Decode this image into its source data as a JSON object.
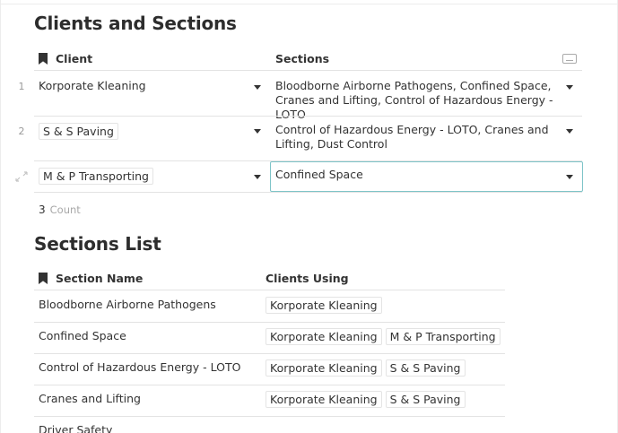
{
  "clients_table": {
    "title": "Clients and Sections",
    "columns": {
      "client": "Client",
      "sections": "Sections"
    },
    "rows": [
      {
        "num": "1",
        "client": "Korporate Kleaning",
        "sections": "Bloodborne Airborne Pathogens, Confined Space, Cranes and Lifting, Control of Hazardous Energy - LOTO"
      },
      {
        "num": "2",
        "client": "S & S Paving",
        "sections": "Control of Hazardous Energy - LOTO, Cranes and Lifting, Dust Control"
      },
      {
        "num": "",
        "client": "M & P Transporting",
        "sections": "Confined Space"
      }
    ],
    "count_value": "3",
    "count_label": "Count"
  },
  "sections_table": {
    "title": "Sections List",
    "columns": {
      "section_name": "Section Name",
      "clients_using": "Clients Using"
    },
    "rows": [
      {
        "name": "Bloodborne Airborne Pathogens",
        "clients": [
          "Korporate Kleaning"
        ]
      },
      {
        "name": "Confined Space",
        "clients": [
          "Korporate Kleaning",
          "M & P Transporting"
        ]
      },
      {
        "name": "Control of Hazardous Energy - LOTO",
        "clients": [
          "Korporate Kleaning",
          "S & S Paving"
        ]
      },
      {
        "name": "Cranes and Lifting",
        "clients": [
          "Korporate Kleaning",
          "S & S Paving"
        ]
      },
      {
        "name": "Driver Safety",
        "clients": []
      }
    ]
  },
  "icons": {
    "bookmark": "bookmark-icon",
    "dropdown": "chevron-down-icon",
    "expand": "expand-icon",
    "column_options": "keyboard-icon"
  },
  "colors": {
    "selection_border": "#7ec4c8",
    "grid_line": "#e3e3e3"
  }
}
